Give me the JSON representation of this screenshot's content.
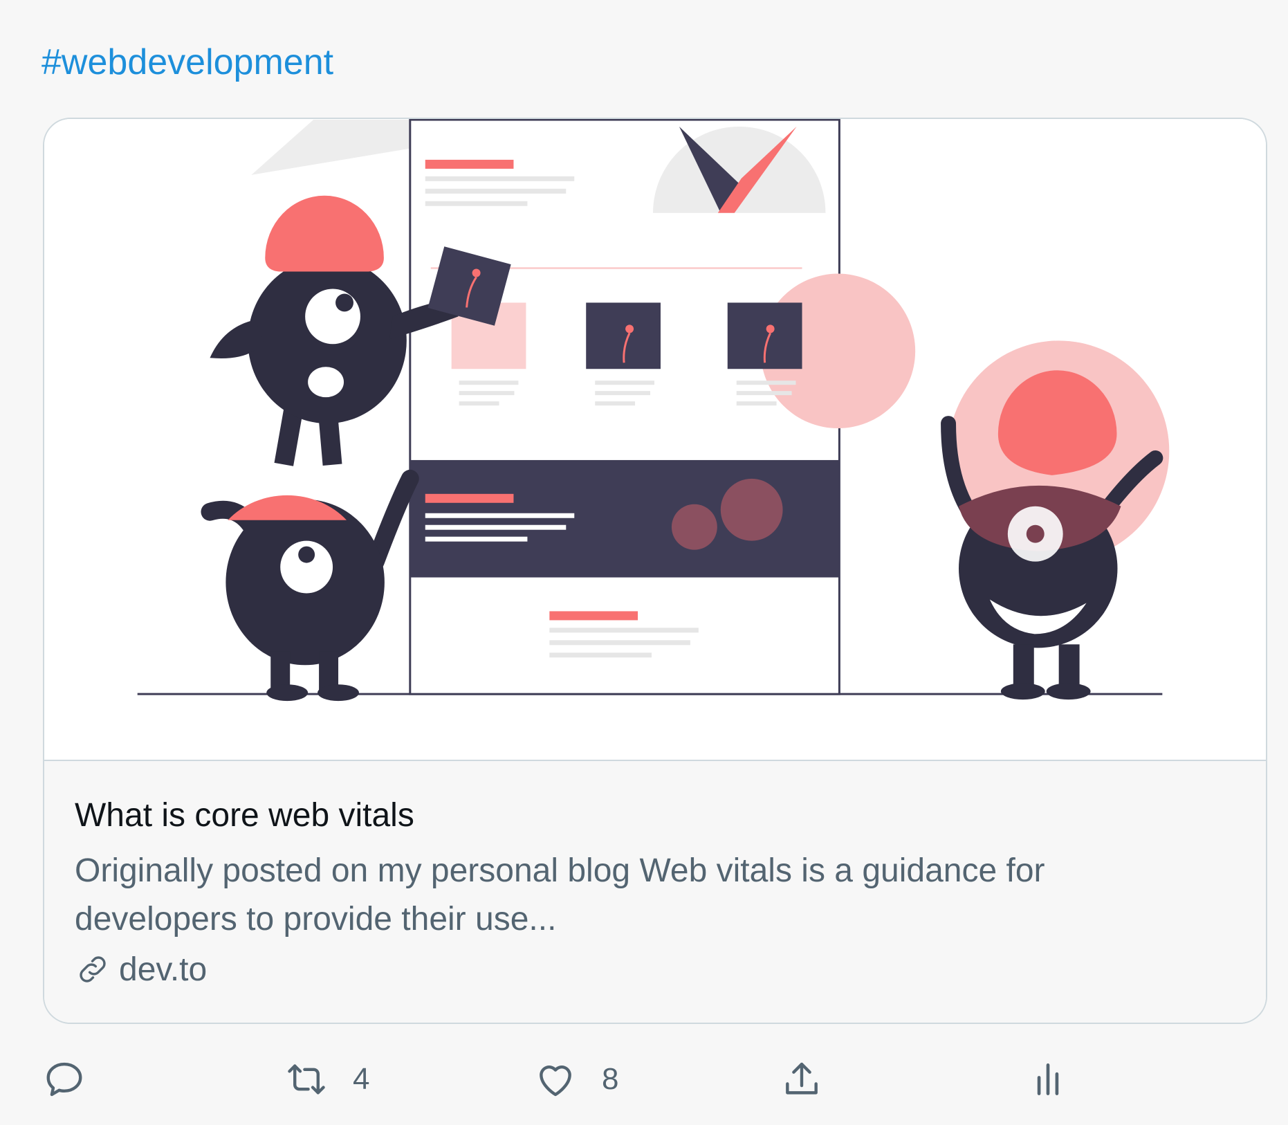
{
  "hashtag": "#webdevelopment",
  "card": {
    "title": "What is core web vitals",
    "description": "Originally posted on my personal blog Web vitals is a guidance for developers to provide their use...",
    "domain": "dev.to",
    "domain_icon": "link-icon"
  },
  "actions": {
    "reply": {
      "icon": "reply-icon",
      "count": ""
    },
    "retweet": {
      "icon": "retweet-icon",
      "count": "4"
    },
    "like": {
      "icon": "heart-icon",
      "count": "8"
    },
    "share": {
      "icon": "share-icon"
    },
    "analytics": {
      "icon": "analytics-icon"
    }
  },
  "colors": {
    "link": "#1d8fdb",
    "muted": "#536471",
    "coral": "#f87171",
    "navy": "#2f2e41",
    "pink": "#f9c4c4"
  }
}
